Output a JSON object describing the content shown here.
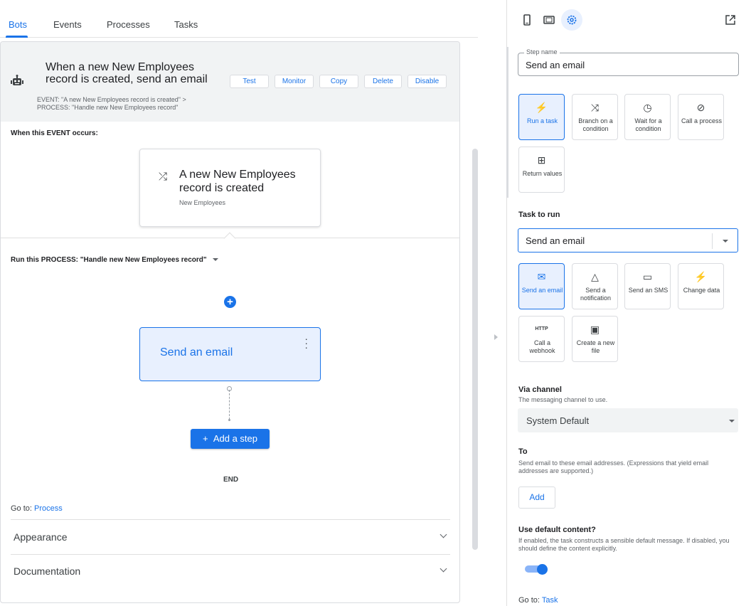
{
  "tabs": [
    {
      "label": "Bots",
      "active": true
    },
    {
      "label": "Events",
      "active": false
    },
    {
      "label": "Processes",
      "active": false
    },
    {
      "label": "Tasks",
      "active": false
    }
  ],
  "bot": {
    "title": "When a new New Employees record is created, send an email",
    "event_line": "EVENT: \"A new New Employees record is created\" >",
    "process_line": "PROCESS: \"Handle new New Employees record\"",
    "icon": "robot-icon",
    "buttons": [
      "Test",
      "Monitor",
      "Copy",
      "Delete",
      "Disable"
    ]
  },
  "event_section": {
    "label": "When this EVENT occurs:",
    "card_title": "A new New Employees record is created",
    "card_sub": "New Employees",
    "icon": "shuffle-icon"
  },
  "process_section": {
    "label": "Run this PROCESS: \"Handle new New Employees record\"",
    "step_title": "Send an email",
    "add_step_label": "Add a step",
    "end_label": "END"
  },
  "footer": {
    "goto_prefix": "Go to:",
    "goto_link": "Process",
    "accordions": [
      "Appearance",
      "Documentation"
    ]
  },
  "right_panel": {
    "top_icons": [
      "phone-icon",
      "tablet-icon",
      "settings-icon",
      "open-in-new-icon"
    ],
    "step_name_label": "Step name",
    "step_name_value": "Send an email",
    "step_types": [
      {
        "label": "Run a task",
        "icon": "bolt-icon",
        "selected": true
      },
      {
        "label": "Branch on a condition",
        "icon": "branch-icon",
        "selected": false
      },
      {
        "label": "Wait for a condition",
        "icon": "clock-icon",
        "selected": false
      },
      {
        "label": "Call a process",
        "icon": "call-process-icon",
        "selected": false
      },
      {
        "label": "Return values",
        "icon": "return-icon",
        "selected": false
      }
    ],
    "task_heading": "Task to run",
    "task_value": "Send an email",
    "task_types": [
      {
        "label": "Send an email",
        "icon": "mail-icon",
        "selected": true
      },
      {
        "label": "Send a notification",
        "icon": "bell-icon",
        "selected": false
      },
      {
        "label": "Send an SMS",
        "icon": "sms-icon",
        "selected": false
      },
      {
        "label": "Change data",
        "icon": "bolt-icon",
        "selected": false
      },
      {
        "label": "Call a webhook",
        "icon": "http-icon",
        "selected": false
      },
      {
        "label": "Create a new file",
        "icon": "new-file-icon",
        "selected": false
      }
    ],
    "http_text": "HTTP",
    "via_channel_heading": "Via channel",
    "via_channel_desc": "The messaging channel to use.",
    "channel_value": "System Default",
    "to_heading": "To",
    "to_desc": "Send email to these email addresses. (Expressions that yield email addresses are supported.)",
    "add_label": "Add",
    "default_content_heading": "Use default content?",
    "default_content_desc": "If enabled, the task constructs a sensible default message. If disabled, you should define the content explicitly.",
    "default_content_enabled": true,
    "goto_prefix": "Go to:",
    "goto_link": "Task"
  },
  "colors": {
    "accent": "#1a73e8",
    "selected_bg": "#e8f0fe",
    "header_bg": "#f1f3f4"
  }
}
